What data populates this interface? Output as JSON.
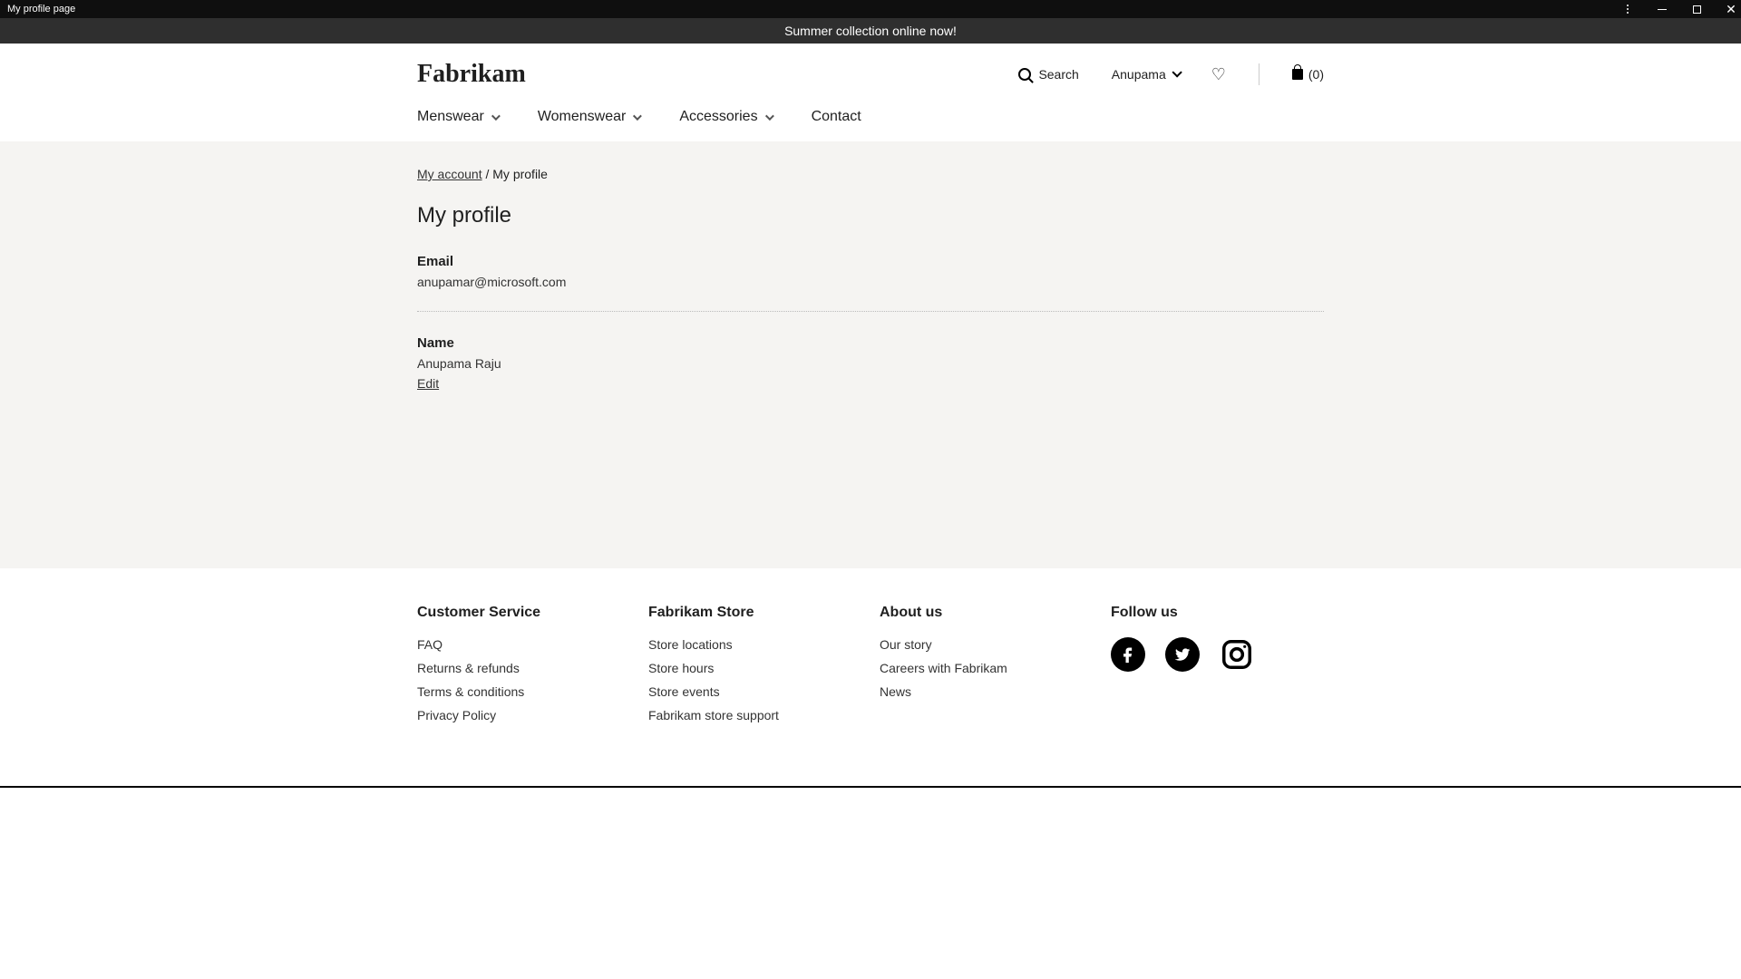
{
  "window": {
    "title": "My profile page"
  },
  "announcement": "Summer collection online now!",
  "header": {
    "logo": "Fabrikam",
    "search_label": "Search",
    "account_name": "Anupama",
    "cart_count": "(0)"
  },
  "nav": {
    "menswear": "Menswear",
    "womenswear": "Womenswear",
    "accessories": "Accessories",
    "contact": "Contact"
  },
  "breadcrumb": {
    "level1": "My account",
    "separator": " / ",
    "level2": "My profile"
  },
  "page": {
    "title": "My profile",
    "email_label": "Email",
    "email_value": "anupamar@microsoft.com",
    "name_label": "Name",
    "name_value": "Anupama Raju",
    "edit_label": "Edit"
  },
  "footer": {
    "col1": {
      "heading": "Customer Service",
      "link1": "FAQ",
      "link2": "Returns & refunds",
      "link3": "Terms & conditions",
      "link4": "Privacy Policy"
    },
    "col2": {
      "heading": "Fabrikam Store",
      "link1": "Store locations",
      "link2": "Store hours",
      "link3": "Store events",
      "link4": "Fabrikam store support"
    },
    "col3": {
      "heading": "About us",
      "link1": "Our story",
      "link2": "Careers with Fabrikam",
      "link3": "News"
    },
    "col4": {
      "heading": "Follow us"
    }
  }
}
